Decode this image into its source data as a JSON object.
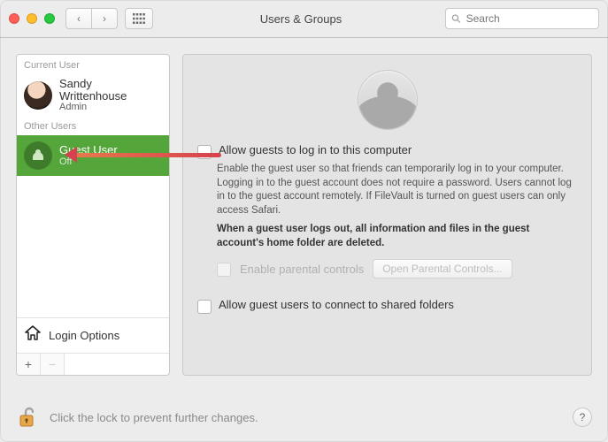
{
  "header": {
    "title": "Users & Groups",
    "search_placeholder": "Search"
  },
  "sidebar": {
    "current_header": "Current User",
    "other_header": "Other Users",
    "current": {
      "name": "Sandy Writtenhouse",
      "role": "Admin"
    },
    "guest": {
      "name": "Guest User",
      "status": "Off"
    },
    "login_options_label": "Login Options"
  },
  "main": {
    "allow_login_label": "Allow guests to log in to this computer",
    "desc": "Enable the guest user so that friends can temporarily log in to your computer. Logging in to the guest account does not require a password. Users cannot log in to the guest account remotely. If FileVault is turned on guest users can only access Safari.",
    "desc_bold": "When a guest user logs out, all information and files in the guest account's home folder are deleted.",
    "parental_label": "Enable parental controls",
    "parental_button": "Open Parental Controls...",
    "shared_label": "Allow guest users to connect to shared folders"
  },
  "footer": {
    "lock_text": "Click the lock to prevent further changes.",
    "help_label": "?"
  }
}
